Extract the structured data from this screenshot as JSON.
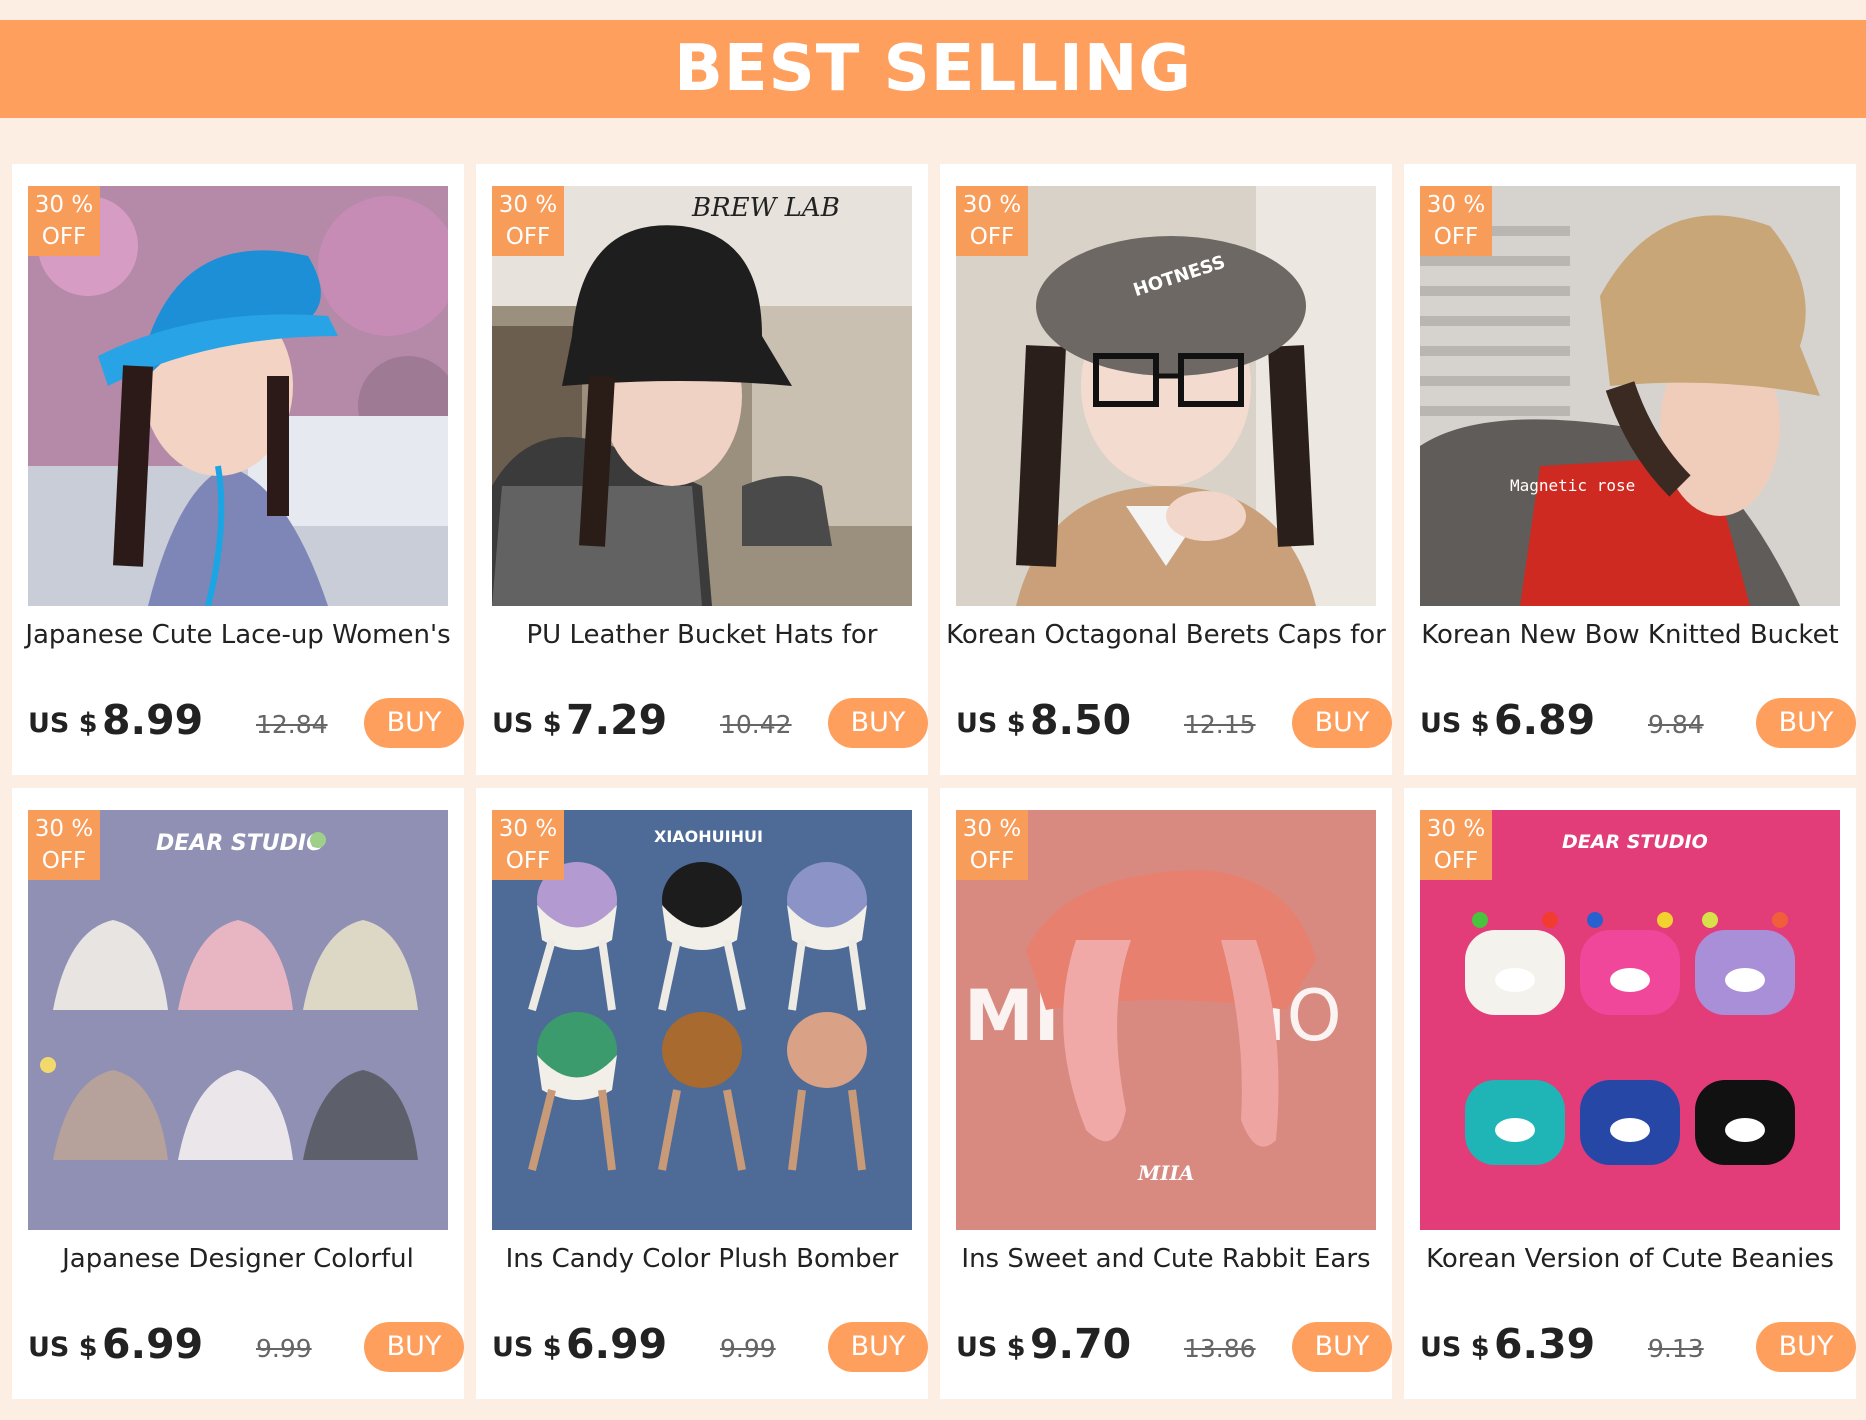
{
  "banner": {
    "title": "BEST SELLING"
  },
  "badge": {
    "line1": "30 %",
    "line2": "OFF"
  },
  "currency": "US $",
  "buy_label": "BUY",
  "products": [
    {
      "title": "Japanese Cute Lace-up Women's",
      "price": "8.99",
      "old_price": "12.84",
      "image": "woman-blue-bucket-hat"
    },
    {
      "title": "PU Leather Bucket Hats for",
      "price": "7.29",
      "old_price": "10.42",
      "image": "woman-black-leather-bucket-hat"
    },
    {
      "title": "Korean Octagonal Berets Caps for",
      "price": "8.50",
      "old_price": "12.15",
      "image": "woman-grey-beret-glasses"
    },
    {
      "title": "Korean New Bow Knitted Bucket",
      "price": "6.89",
      "old_price": "9.84",
      "image": "woman-beige-knitted-bucket-hat"
    },
    {
      "title": "Japanese Designer Colorful",
      "price": "6.99",
      "old_price": "9.99",
      "image": "six-speckled-bucket-hats"
    },
    {
      "title": "Ins Candy Color Plush Bomber",
      "price": "6.99",
      "old_price": "9.99",
      "image": "six-plush-bomber-hats"
    },
    {
      "title": "Ins Sweet and Cute Rabbit Ears",
      "price": "9.70",
      "old_price": "13.86",
      "image": "pink-rabbit-ear-hat"
    },
    {
      "title": "Korean Version of Cute Beanies",
      "price": "6.39",
      "old_price": "9.13",
      "image": "six-colorful-eye-beanies"
    }
  ],
  "image_text": {
    "brew_lab": "BREW LAB",
    "hotness": "HOTNESS",
    "magnetic_rose": "Magnetic rose",
    "dear_studio": "DEAR STUDIO",
    "xiaohuihui": "XIAOHUIHUI",
    "miia": "MIIA"
  }
}
